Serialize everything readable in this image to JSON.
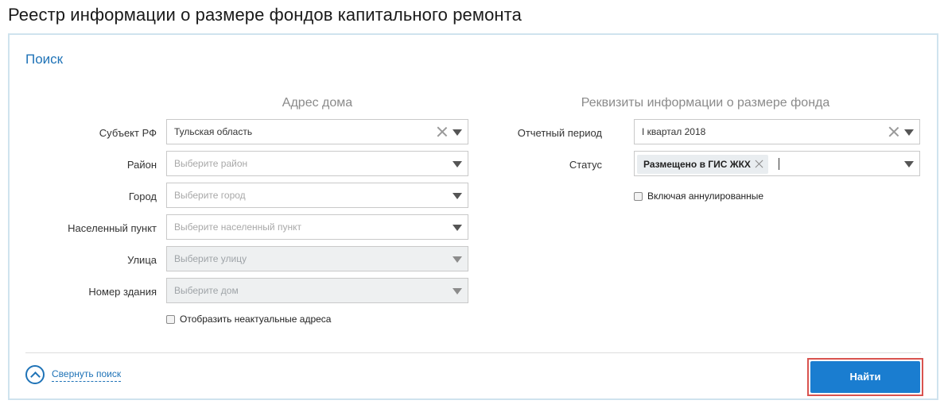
{
  "page": {
    "title": "Реестр информации о размере фондов капитального ремонта"
  },
  "search": {
    "title": "Поиск",
    "address": {
      "heading": "Адрес дома",
      "subject": {
        "label": "Субъект РФ",
        "value": "Тульская область"
      },
      "district": {
        "label": "Район",
        "placeholder": "Выберите район"
      },
      "city": {
        "label": "Город",
        "placeholder": "Выберите город"
      },
      "settlement": {
        "label": "Населенный пункт",
        "placeholder": "Выберите населенный пункт"
      },
      "street": {
        "label": "Улица",
        "placeholder": "Выберите улицу"
      },
      "building": {
        "label": "Номер здания",
        "placeholder": "Выберите дом"
      },
      "show_obsolete_label": "Отобразить неактуальные адреса"
    },
    "fund": {
      "heading": "Реквизиты информации о размере фонда",
      "period": {
        "label": "Отчетный период",
        "value": "I квартал 2018"
      },
      "status": {
        "label": "Статус",
        "tag": "Размещено в ГИС ЖКХ"
      },
      "include_cancelled_label": "Включая аннулированные"
    },
    "collapse_label": "Свернуть поиск",
    "find_button": "Найти"
  },
  "colors": {
    "accent": "#1f73b7",
    "button": "#1a7dd0",
    "highlight": "#d9534f"
  }
}
